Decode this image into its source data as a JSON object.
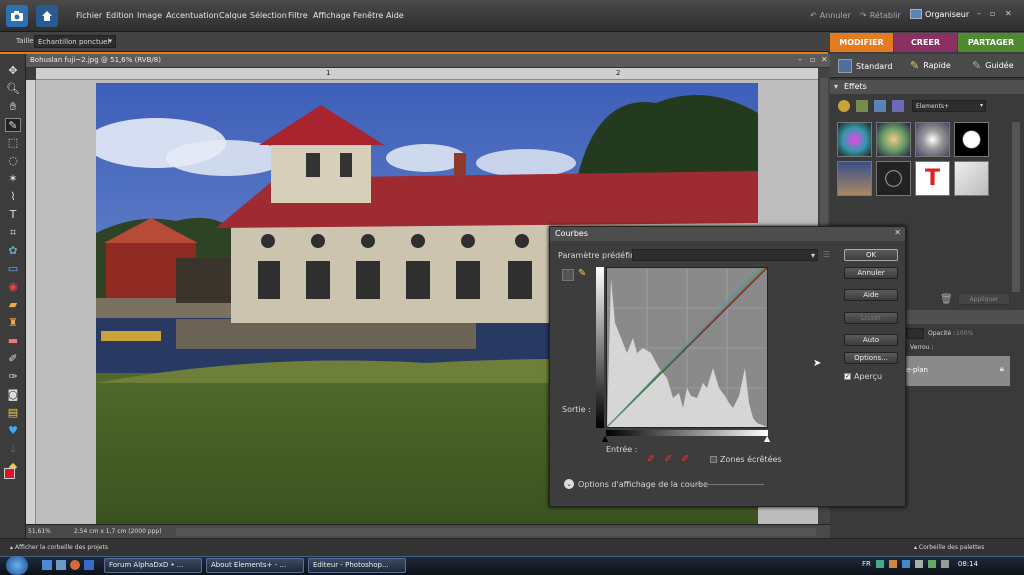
{
  "menubar": {
    "items": [
      "Fichier",
      "Edition",
      "Image",
      "Accentuation",
      "Calque",
      "Sélection",
      "Filtre",
      "Affichage",
      "Fenêtre",
      "Aide"
    ],
    "undo": "Annuler",
    "redo": "Rétablir",
    "organizer": "Organiseur"
  },
  "optbar": {
    "size_label": "Taille :",
    "mode_value": "Echantillon ponctuel"
  },
  "tabs": {
    "modify": "MODIFIER",
    "create": "CREER",
    "share": "PARTAGER"
  },
  "modes": {
    "standard": "Standard",
    "quick": "Rapide",
    "guided": "Guidée"
  },
  "document": {
    "title": "Bohuslan fuji~2.jpg @ 51,6% (RVB/8)",
    "ruler_1": "1",
    "ruler_2": "2",
    "zoom": "51,61%",
    "size": "2,54 cm x 1,7 cm (2000 ppp)"
  },
  "effects": {
    "title": "Effets",
    "library": "Elements+"
  },
  "layers": {
    "opacity_label": "Opacité :",
    "opacity_value": "100%",
    "lock_label": "Verrou :",
    "layer_name": "e-plan",
    "apply": "Appliquer"
  },
  "bottombar": {
    "left": "Afficher la corbeille des projets",
    "right": "Corbeille des palettes"
  },
  "dialog": {
    "title": "Courbes",
    "preset_label": "Paramètre prédéfini :",
    "ok": "OK",
    "cancel": "Annuler",
    "help": "Aide",
    "smooth": "Lisser",
    "auto": "Auto",
    "options": "Options...",
    "preview": "Aperçu",
    "output_label": "Sortie :",
    "input_label": "Entrée :",
    "clipping": "Zones écrêtées",
    "display_options": "Options d'affichage de la courbe"
  },
  "taskbar": {
    "tasks": [
      "Forum AlphaDxD • ...",
      "About Elements+ - ...",
      "Editeur - Photoshop..."
    ],
    "lang": "FR",
    "time": "08:14"
  },
  "colors": {
    "accent": "#e57a1e",
    "modify": "#e57a1e",
    "create": "#8c2f62",
    "share": "#4f8a2f"
  }
}
